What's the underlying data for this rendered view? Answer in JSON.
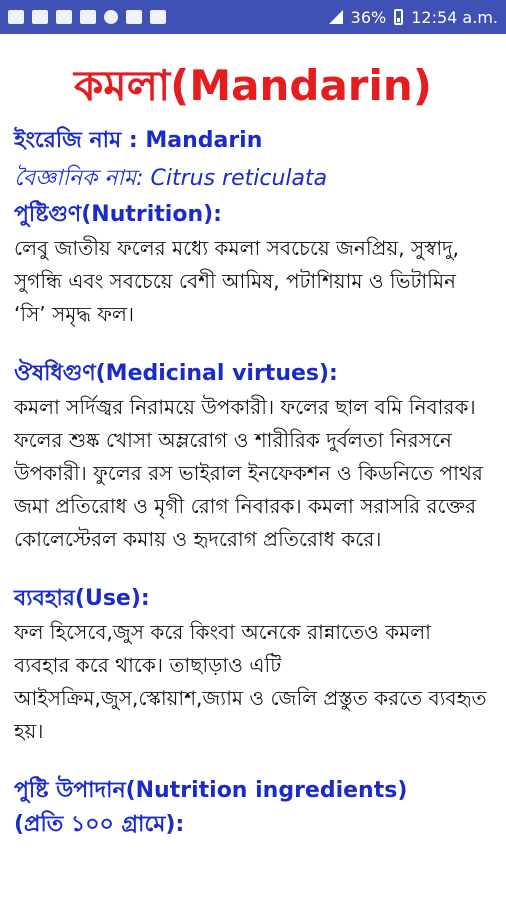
{
  "status_bar": {
    "battery_percent": "36%",
    "time": "12:54 a.m."
  },
  "title": "কমলা(Mandarin)",
  "english_name": "ইংরেজি নাম : Mandarin",
  "scientific_name": "বৈজ্ঞানিক নাম: Citrus reticulata",
  "sections": {
    "nutrition": {
      "heading": "পুষ্টিগুণ(Nutrition):",
      "text": "লেবু জাতীয় ফলের মধ্যে কমলা সবচেয়ে জনপ্রিয়, সুস্বাদু, সুগন্ধি এবং সবচেয়ে বেশী আমিষ, পটাশিয়াম ও ভিটামিন ‘সি’ সমৃদ্ধ ফল।"
    },
    "medicinal": {
      "heading": "ঔষধিগুণ(Medicinal virtues):",
      "text": "কমলা সর্দিজ্বর নিরাময়ে উপকারী। ফলের ছাল বমি নিবারক। ফলের শুষ্ক খোসা অম্লরোগ ও শারীরিক দুর্বলতা নিরসনে উপকারী। ফুলের রস ভাইরাল ইনফেকশন ও কিডনিতে পাথর জমা প্রতিরোধ ও মৃগী রোগ নিবারক। কমলা সরাসরি রক্তের কোলেস্টেরল কমায় ও হৃদরোগ প্রতিরোধ করে।"
    },
    "use": {
      "heading": "ব্যবহার(Use):",
      "text": "ফল হিসেবে,জুস করে কিংবা অনেকে রান্নাতেও কমলা ব্যবহার করে থাকে। তাছাড়াও এটি আইসক্রিম,জুস,স্কোয়াশ,জ্যাম ও জেলি প্রস্তুত করতে ব্যবহৃত হয়।"
    },
    "ingredients": {
      "heading": "পুষ্টি উপাদান(Nutrition ingredients)",
      "subheading": "(প্রতি ১০০ গ্রামে):"
    }
  }
}
